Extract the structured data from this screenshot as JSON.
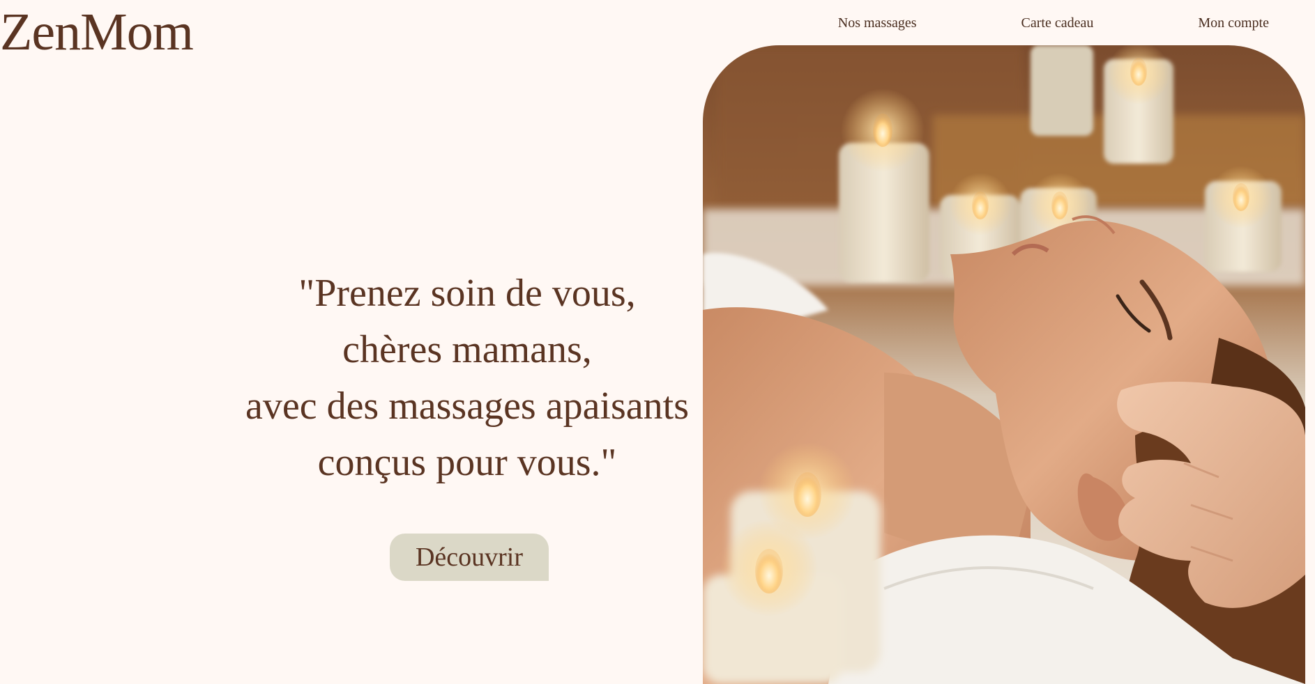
{
  "header": {
    "logo": "ZenMom",
    "nav": [
      {
        "label": "Nos massages"
      },
      {
        "label": "Carte cadeau"
      },
      {
        "label": "Mon compte"
      }
    ]
  },
  "hero": {
    "quote_lines": [
      "\"Prenez soin de vous,",
      "chères mamans,",
      "avec des massages apaisants",
      "conçus pour vous.\""
    ],
    "cta_label": "Découvrir"
  },
  "photo": {
    "subject": "spa-massage-photo",
    "colors": {
      "background_warm": "#8a5a36",
      "candle": "#eee3cf",
      "flame": "#ffe2a4",
      "skin": "#d8a07c",
      "hair": "#6a3b1e",
      "towel": "#f4f1ec"
    }
  },
  "theme": {
    "background": "#fff8f4",
    "text": "#5a3422",
    "button_bg": "#dbd8c7"
  }
}
